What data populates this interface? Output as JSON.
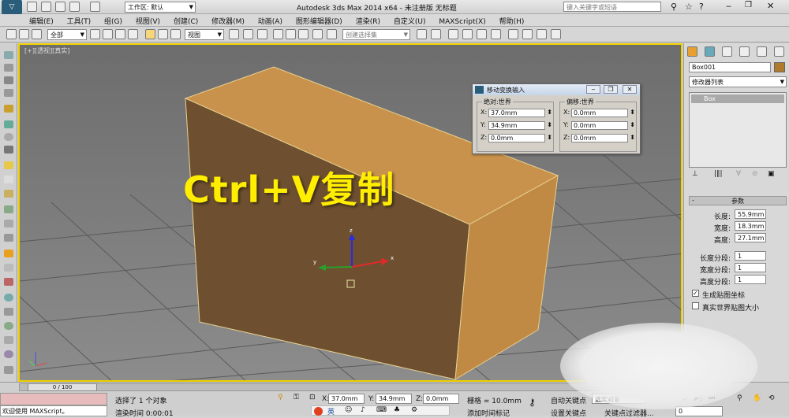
{
  "titlebar": {
    "workspace_label": "工作区: 默认",
    "title": "Autodesk 3ds Max  2014 x64   - 未注册版   无标题",
    "search_placeholder": "键入关键字或短语"
  },
  "menu": [
    "编辑(E)",
    "工具(T)",
    "组(G)",
    "视图(V)",
    "创建(C)",
    "修改器(M)",
    "动画(A)",
    "图形编辑器(D)",
    "渲染(R)",
    "自定义(U)",
    "MAXScript(X)",
    "帮助(H)"
  ],
  "toolbar": {
    "filter": "全部",
    "refcoord": "视图",
    "selection_set": "创建选择集"
  },
  "viewport": {
    "label": "[+][透视][真实]",
    "overlay_text": "Ctrl+V复制",
    "axis_x": "x",
    "axis_y": "y",
    "axis_z": "z"
  },
  "dialog": {
    "title": "移动变换输入",
    "absolute": {
      "title": "绝对:世界",
      "x_label": "X:",
      "x": "37.0mm",
      "y_label": "Y:",
      "y": "34.9mm",
      "z_label": "Z:",
      "z": "0.0mm"
    },
    "offset": {
      "title": "偏移:世界",
      "x_label": "X:",
      "x": "0.0mm",
      "y_label": "Y:",
      "y": "0.0mm",
      "z_label": "Z:",
      "z": "0.0mm"
    }
  },
  "cmdpanel": {
    "object_name": "Box001",
    "modifier_list": "修改器列表",
    "stack_item": "Box",
    "rollout_title": "参数",
    "params": [
      {
        "label": "长度:",
        "value": "55.9mm"
      },
      {
        "label": "宽度:",
        "value": "18.3mm"
      },
      {
        "label": "高度:",
        "value": "27.1mm"
      }
    ],
    "segs": [
      {
        "label": "长度分段:",
        "value": "1"
      },
      {
        "label": "宽度分段:",
        "value": "1"
      },
      {
        "label": "高度分段:",
        "value": "1"
      }
    ],
    "gen_map": "生成贴图坐标",
    "real_world": "真实世界贴图大小"
  },
  "status": {
    "timeslider": "0 / 100",
    "selected": "选择了 1 个对象",
    "x_label": "X:",
    "x": "37.0mm",
    "y_label": "Y:",
    "y": "34.9mm",
    "z_label": "Z:",
    "z": "0.0mm",
    "grid": "栅格 = 10.0mm",
    "autokey": "自动关键点",
    "setkey": "设置关键点",
    "key_select": "选定对象",
    "key_filter": "关键点过滤器...",
    "frame": "0",
    "maxscript": "欢迎使用 MAXScript。",
    "render_time": "渲染时间  0:00:01",
    "add_tag": "添加时间标记",
    "ime": "英"
  }
}
